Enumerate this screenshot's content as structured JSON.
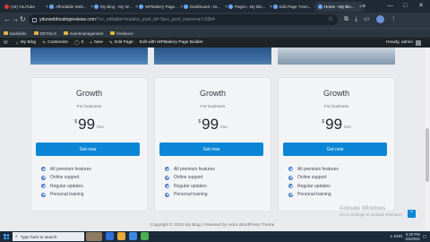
{
  "browser": {
    "tabs": [
      {
        "label": "(44) YouTube",
        "active": false
      },
      {
        "label": "Affordable Web...",
        "active": false
      },
      {
        "label": "My Blog - My W...",
        "active": false
      },
      {
        "label": "WPBakery Page...",
        "active": false
      },
      {
        "label": "Dashboard ‹ M...",
        "active": false
      },
      {
        "label": "Pages ‹ My Blo...",
        "active": false
      },
      {
        "label": "Edit Page “Hom...",
        "active": false
      },
      {
        "label": "Home - My Blo...",
        "active": true
      }
    ],
    "new_tab": "+",
    "url_host": "ydurwebhostingreviews.com",
    "url_path": "/?vc_editable=true&vc_post_id=7&vc_post_nonce=a7c03b4",
    "window_controls": [
      "—",
      "□",
      "✕"
    ]
  },
  "bookmarks": [
    {
      "label": "backlinks"
    },
    {
      "label": "DETAILS"
    },
    {
      "label": "eventmanagement"
    },
    {
      "label": "freelance"
    }
  ],
  "wp_admin_bar": {
    "items": [
      {
        "icon": "W",
        "label": ""
      },
      {
        "icon": "⌂",
        "label": "My Blog"
      },
      {
        "icon": "✎",
        "label": "Customize"
      },
      {
        "icon": "◯",
        "label": "0"
      },
      {
        "icon": "+",
        "label": "New"
      },
      {
        "icon": "✎",
        "label": "Edit Page"
      },
      {
        "icon": "",
        "label": "Edit with WPBakery Page Builder"
      }
    ],
    "howdy": "Howdy, admin"
  },
  "pricing_cards": [
    {
      "title": "Growth",
      "subtitle": "For business",
      "currency": "$",
      "amount": "99",
      "period": "/mo",
      "button": "Get now",
      "features": [
        "All premium features",
        "Online support",
        "Regular updates",
        "Personal training"
      ]
    },
    {
      "title": "Growth",
      "subtitle": "For business",
      "currency": "$",
      "amount": "99",
      "period": "/mo",
      "button": "Get now",
      "features": [
        "All premium features",
        "Online support",
        "Regular updates",
        "Personal training"
      ]
    },
    {
      "title": "Growth",
      "subtitle": "For business",
      "currency": "$",
      "amount": "99",
      "period": "/mo",
      "button": "Get now",
      "features": [
        "All premium features",
        "Online support",
        "Regular updates",
        "Personal training"
      ]
    }
  ],
  "footer": "Copyright © 2024 My Blog | Powered by Astra WordPress Theme",
  "watermark": {
    "title": "Activate Windows",
    "subtitle": "Go to Settings to activate Windows."
  },
  "taskbar": {
    "search_placeholder": "Type here to search",
    "tray_text": "∧  ENG",
    "time": "5:20 PM",
    "date": "4/4/2024"
  },
  "colors": {
    "button": "#0b86d6",
    "check": "#3f7fc8"
  }
}
